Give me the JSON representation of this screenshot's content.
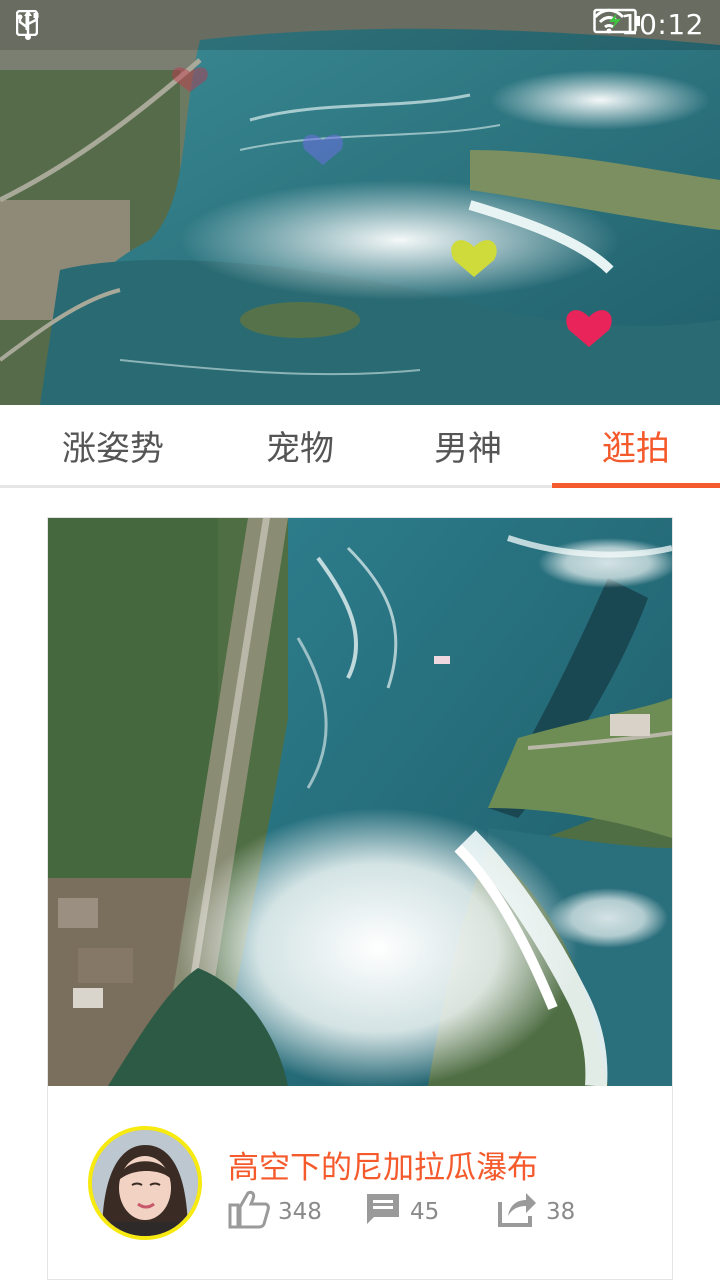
{
  "status_bar": {
    "time": "10:12",
    "icons": [
      "alert-icon",
      "usb-icon",
      "wifi-icon",
      "battery-charging-icon"
    ]
  },
  "hero": {
    "image": "niagara-falls-aerial-photo",
    "floating_hearts": [
      "heart-icon-red-faded",
      "heart-icon-blue-faded",
      "heart-icon-yellow",
      "heart-icon-pink"
    ]
  },
  "tabs": {
    "items": [
      {
        "label": "涨姿势"
      },
      {
        "label": "宠物"
      },
      {
        "label": "男神"
      },
      {
        "label": "逛拍"
      }
    ],
    "active_index": 3
  },
  "card": {
    "image": "niagara-falls-aerial-photo",
    "title": "高空下的尼加拉瓜瀑布",
    "likes": "348",
    "comments": "45",
    "shares": "38"
  },
  "colors": {
    "accent": "#f55a2c",
    "avatar_border": "#f7ea10",
    "stat_icon": "#9a9a9a"
  }
}
